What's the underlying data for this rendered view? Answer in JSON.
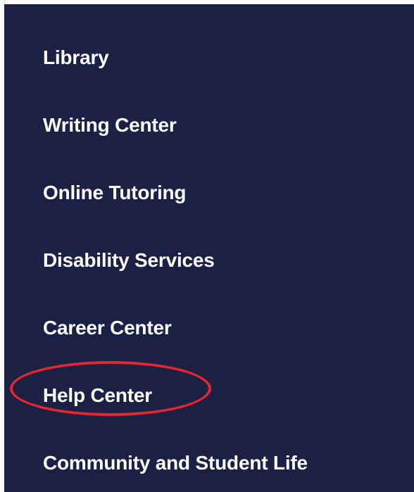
{
  "nav": {
    "items": [
      {
        "label": "Library"
      },
      {
        "label": "Writing Center"
      },
      {
        "label": "Online Tutoring"
      },
      {
        "label": "Disability Services"
      },
      {
        "label": "Career Center"
      },
      {
        "label": "Help Center"
      },
      {
        "label": "Community and Student Life"
      }
    ]
  },
  "colors": {
    "panel_background": "#1b2144",
    "text": "#ffffff",
    "annotation_circle": "#e5262e"
  }
}
